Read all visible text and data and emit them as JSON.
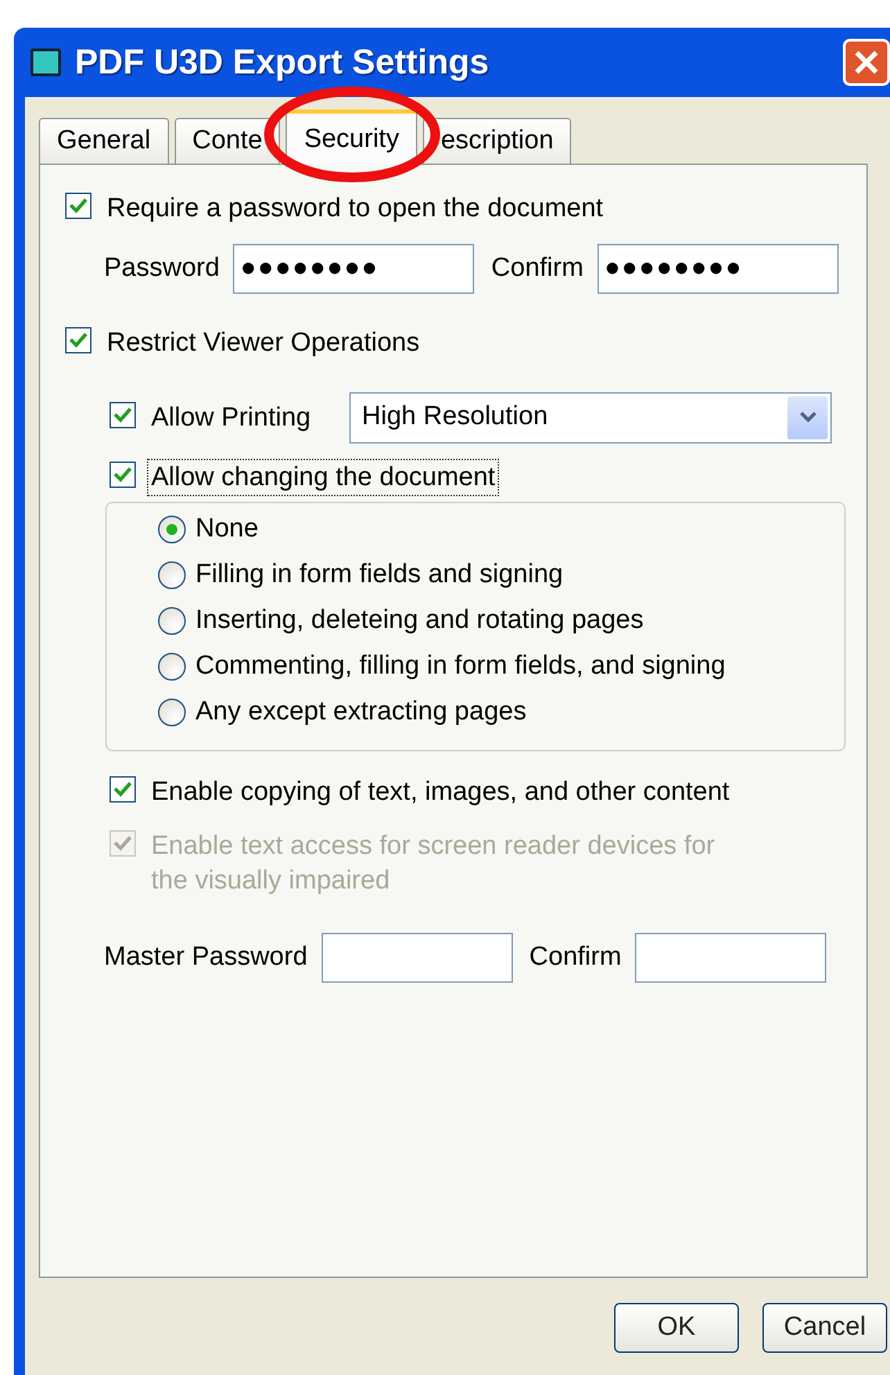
{
  "window": {
    "title": "PDF U3D Export Settings"
  },
  "tabs": [
    {
      "label": "General",
      "selected": false
    },
    {
      "label": "Conte",
      "selected": false
    },
    {
      "label": "Security",
      "selected": true
    },
    {
      "label": "escription",
      "selected": false
    }
  ],
  "require_password": {
    "label": "Require a password to open the document",
    "checked": true
  },
  "password_fields": [
    {
      "label": "Password",
      "value": "●●●●●●●●"
    },
    {
      "label": "Confirm",
      "value": "●●●●●●●●"
    }
  ],
  "restrict": {
    "label": "Restrict Viewer Operations",
    "checked": true
  },
  "allow_printing": {
    "label": "Allow Printing",
    "checked": true,
    "value": "High Resolution"
  },
  "allow_changing": {
    "label": "Allow changing the document",
    "checked": true,
    "focused": true
  },
  "change_options": [
    {
      "label": "None",
      "selected": true
    },
    {
      "label": "Filling in form fields and signing",
      "selected": false
    },
    {
      "label": "Inserting, deleteing and rotating pages",
      "selected": false
    },
    {
      "label": "Commenting, filling in form fields, and signing",
      "selected": false
    },
    {
      "label": "Any except extracting pages",
      "selected": false
    }
  ],
  "enable_copying": {
    "label": "Enable copying of text, images, and other content",
    "checked": true
  },
  "screen_reader": {
    "label": "Enable text access for screen reader devices for the visually impaired",
    "checked": true,
    "disabled": true
  },
  "master_fields": [
    {
      "label": "Master Password"
    },
    {
      "label": "Confirm"
    }
  ],
  "buttons": [
    "OK",
    "Cancel"
  ]
}
